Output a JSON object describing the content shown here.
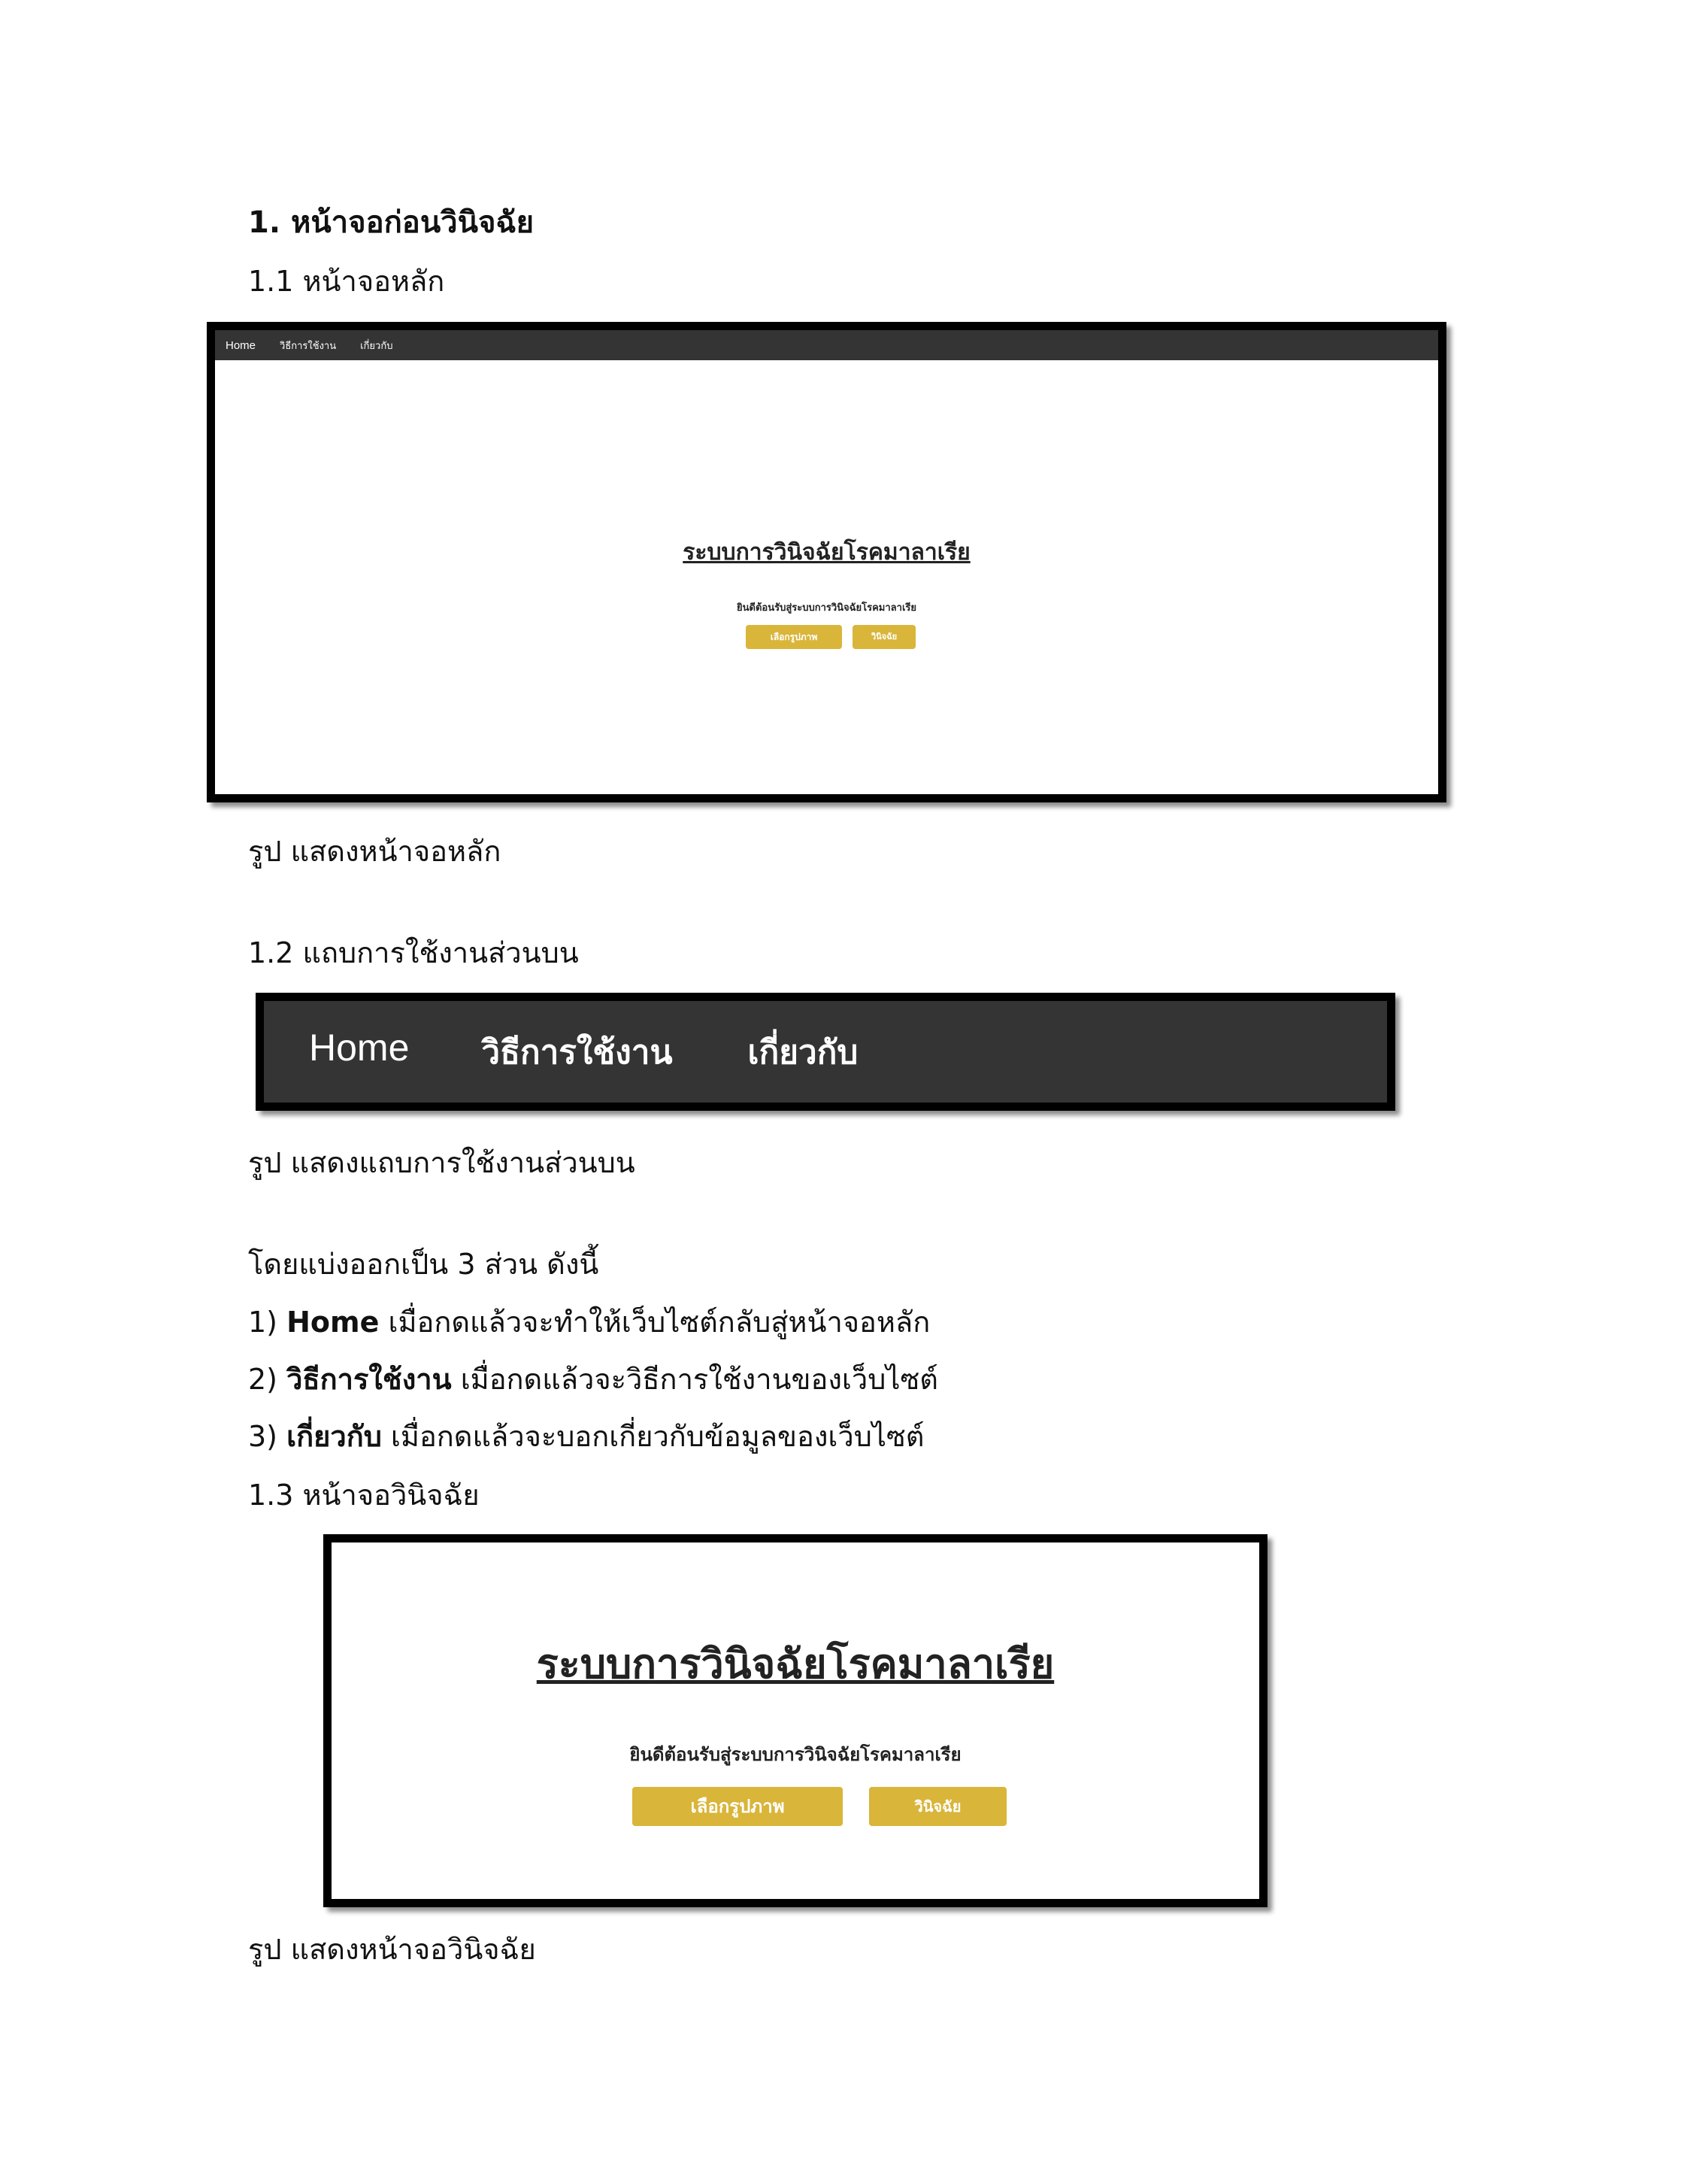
{
  "heading": "1. หน้าจอก่อนวินิจฉัย",
  "sec_1_1": "1.1 หน้าจอหลัก",
  "screen_main": {
    "nav": [
      "Home",
      "วิธีการใช้งาน",
      "เกี่ยวกับ"
    ],
    "title": "ระบบการวินิจฉัยโรคมาลาเรีย",
    "subtitle": "ยินดีต้อนรับสู่ระบบการวินิจฉัยโรคมาลาเรีย",
    "btn_select": "เลือกรูปภาพ",
    "btn_diagnose": "วินิจฉัย"
  },
  "caption_1_1": "รูป แสดงหน้าจอหลัก",
  "sec_1_2": "1.2 แถบการใช้งานส่วนบน",
  "navbar": [
    "Home",
    "วิธีการใช้งาน",
    "เกี่ยวกับ"
  ],
  "caption_1_2": "รูป แสดงแถบการใช้งานส่วนบน",
  "intro": "โดยแบ่งออกเป็น 3 ส่วน ดังนี้",
  "items": [
    {
      "num": "1) ",
      "term": "Home",
      "desc": " เมื่อกดแล้วจะทำให้เว็บไซต์กลับสู่หน้าจอหลัก"
    },
    {
      "num": "2) ",
      "term": "วิธีการใช้งาน",
      "desc": " เมื่อกดแล้วจะวิธีการใช้งานของเว็บไซต์"
    },
    {
      "num": "3) ",
      "term": "เกี่ยวกับ",
      "desc": " เมื่อกดแล้วจะบอกเกี่ยวกับข้อมูลของเว็บไซต์"
    }
  ],
  "sec_1_3": "1.3 หน้าจอวินิจฉัย",
  "screen_diag": {
    "title": "ระบบการวินิจฉัยโรคมาลาเรีย",
    "subtitle": "ยินดีต้อนรับสู่ระบบการวินิจฉัยโรคมาลาเรีย",
    "btn_select": "เลือกรูปภาพ",
    "btn_diagnose": "วินิจฉัย"
  },
  "caption_1_3": "รูป แสดงหน้าจอวินิจฉัย",
  "colors": {
    "navbar": "#343434",
    "button": "#d9b53a",
    "frame": "#000000"
  }
}
